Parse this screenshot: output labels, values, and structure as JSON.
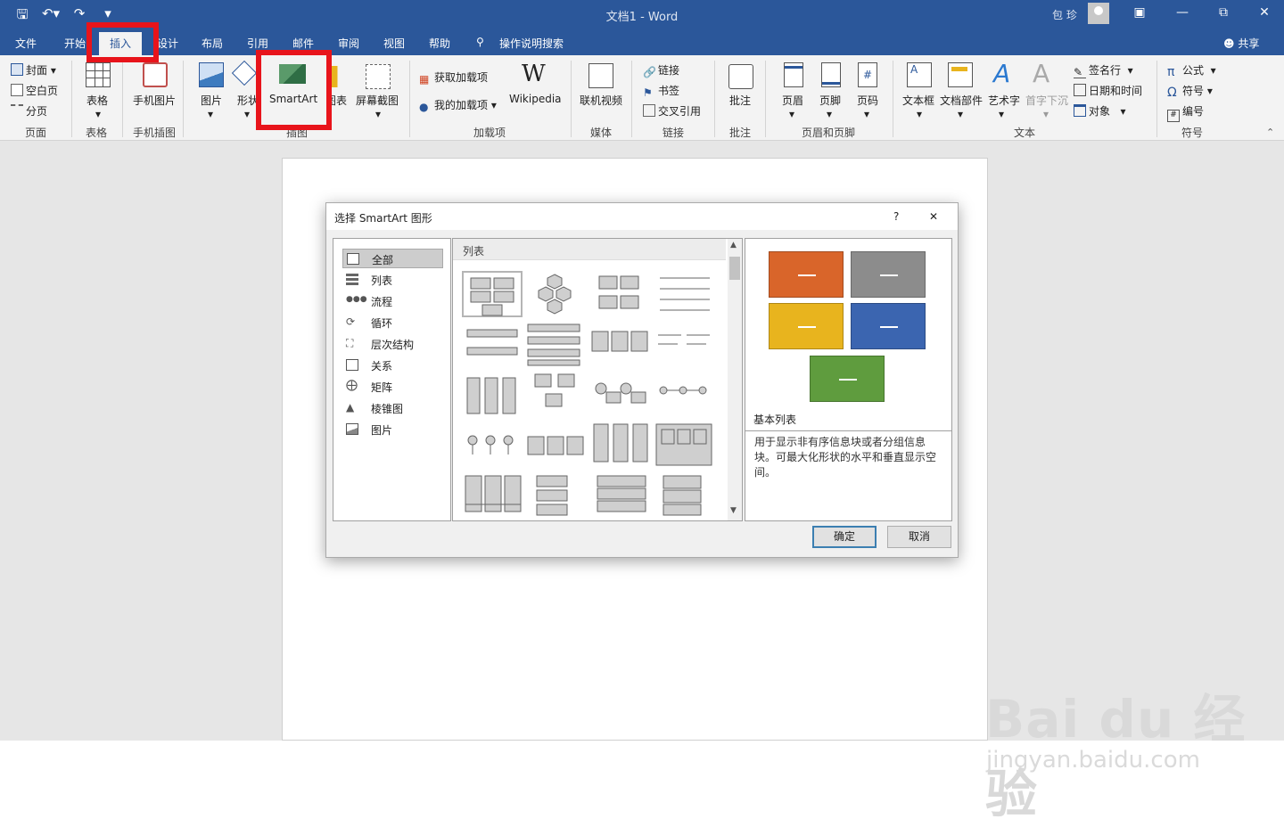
{
  "window": {
    "title": "文档1 - Word",
    "user": "包 珍",
    "share": "共享"
  },
  "tabs": [
    "文件",
    "开始",
    "插入",
    "设计",
    "布局",
    "引用",
    "邮件",
    "审阅",
    "视图",
    "帮助"
  ],
  "tell_me": "操作说明搜索",
  "ribbon": {
    "pages": {
      "cover": "封面",
      "blank": "空白页",
      "break": "分页",
      "group": "页面"
    },
    "tables": {
      "table": "表格",
      "group": "表格"
    },
    "phone": {
      "label": "手机图片",
      "group": "手机插图"
    },
    "illustrations": {
      "pictures": "图片",
      "shapes": "形状",
      "smartart": "SmartArt",
      "chart": "图表",
      "screenshot": "屏幕截图",
      "group": "插图"
    },
    "addins": {
      "get": "获取加载项",
      "my": "我的加载项",
      "wiki": "Wikipedia",
      "group": "加载项"
    },
    "media": {
      "video": "联机视频",
      "group": "媒体"
    },
    "links": {
      "link": "链接",
      "bookmark": "书签",
      "crossref": "交叉引用",
      "group": "链接"
    },
    "comments": {
      "comment": "批注",
      "group": "批注"
    },
    "headerfooter": {
      "header": "页眉",
      "footer": "页脚",
      "pagenum": "页码",
      "group": "页眉和页脚"
    },
    "text": {
      "textbox": "文本框",
      "quickparts": "文档部件",
      "wordart": "艺术字",
      "dropcap": "首字下沉",
      "sigline": "签名行",
      "datetime": "日期和时间",
      "object": "对象",
      "group": "文本"
    },
    "symbols": {
      "equation": "公式",
      "symbol": "符号",
      "number": "编号",
      "group": "符号"
    }
  },
  "dialog": {
    "title": "选择 SmartArt 图形",
    "help": "?",
    "categories": [
      "全部",
      "列表",
      "流程",
      "循环",
      "层次结构",
      "关系",
      "矩阵",
      "棱锥图",
      "图片"
    ],
    "selected_category": "全部",
    "grid_header": "列表",
    "preview": {
      "name": "基本列表",
      "description": "用于显示非有序信息块或者分组信息块。可最大化形状的水平和垂直显示空间。",
      "colors": [
        "#d9652a",
        "#8c8c8c",
        "#e8b41e",
        "#3b65b0",
        "#5f9c3e"
      ]
    },
    "ok": "确定",
    "cancel": "取消"
  },
  "watermark": {
    "brand": "Bai du 经验",
    "url": "jingyan.baidu.com"
  }
}
